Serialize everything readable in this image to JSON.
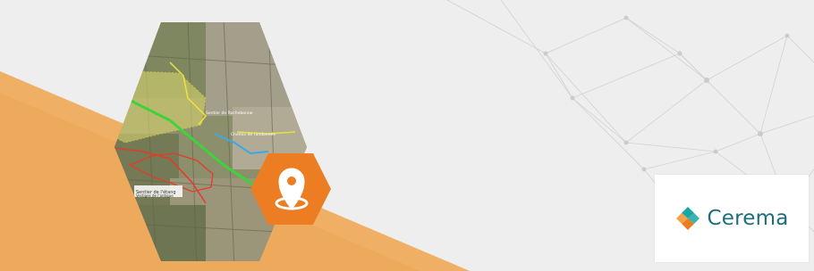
{
  "banner": {
    "brand_name": "Cerema",
    "icon": "map-pin-icon",
    "colors": {
      "background": "#eeeeee",
      "orange_band": "#eeaa5c",
      "pin_hexagon": "#ec7d23",
      "logo_text": "#1d6d7e",
      "logo_teal": "#1aa6a6",
      "logo_orange": "#ea7d1f"
    }
  },
  "map": {
    "labels": [
      "Sentier de l'étang",
      "Sentier de Rochebonne",
      "Chemin de randonnée",
      "Vestiges de l'antique"
    ]
  }
}
